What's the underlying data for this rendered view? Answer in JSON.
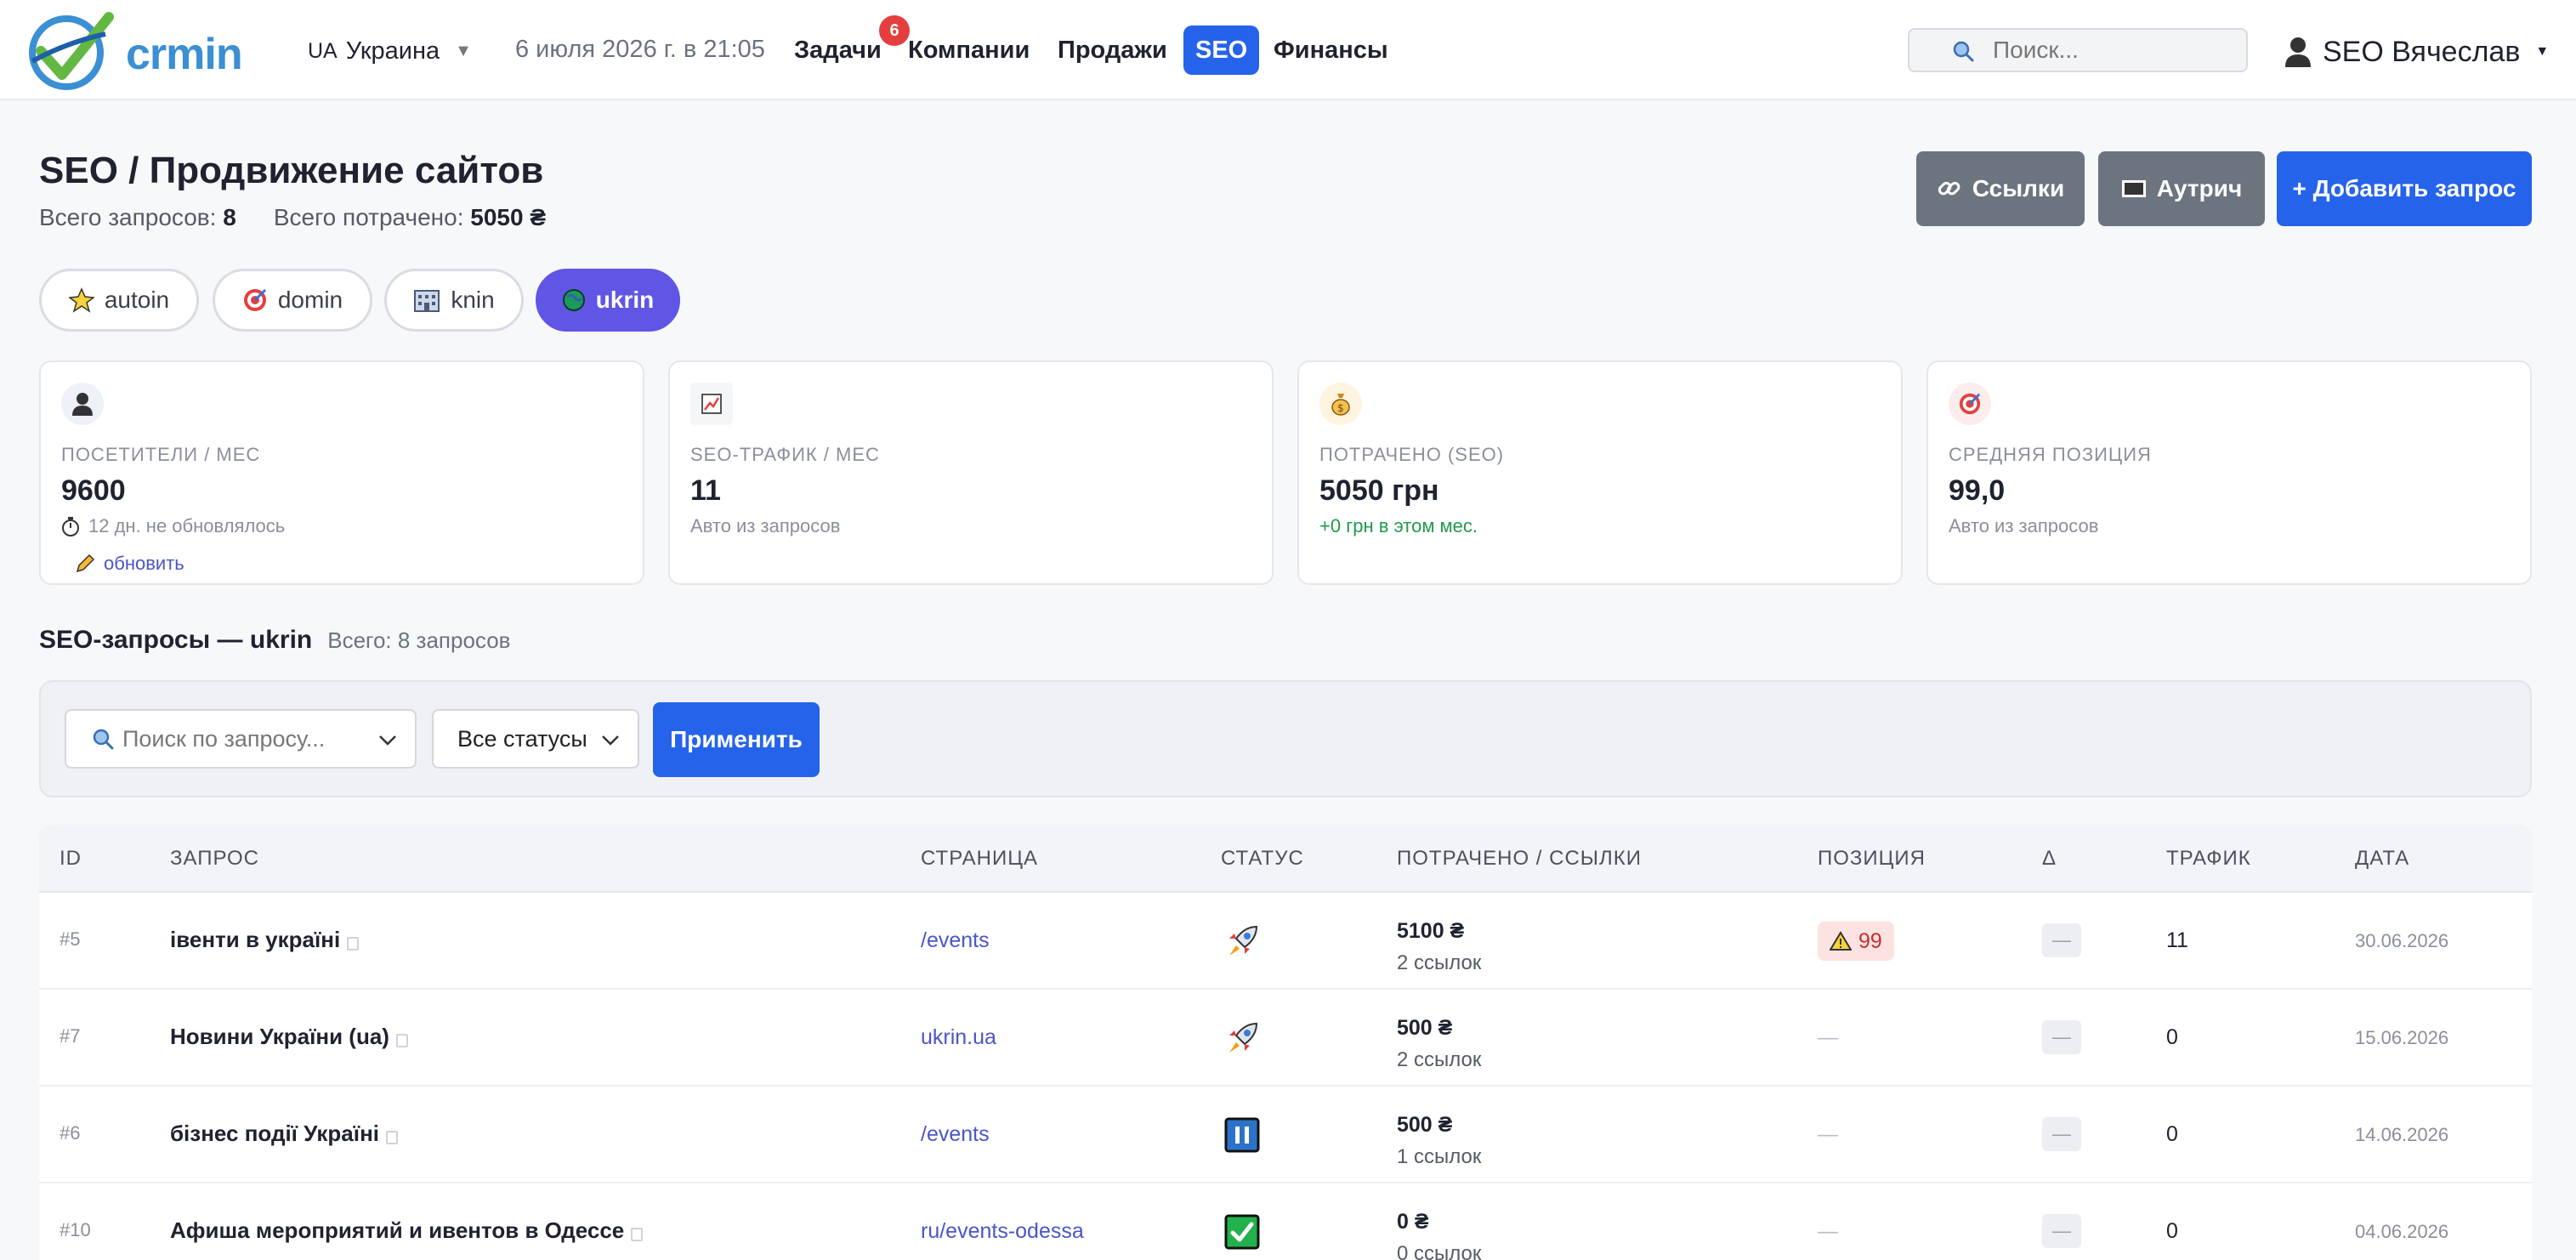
{
  "app": {
    "logo_text": "crmin"
  },
  "nav": {
    "country_code": "UA",
    "country_name": "Украина",
    "datetime": "6 июля 2026 г. в 21:05",
    "items": [
      "Задачи",
      "Компании",
      "Продажи",
      "SEO",
      "Финансы"
    ],
    "tasks_badge": "6",
    "search_placeholder": "Поиск...",
    "user_name": "SEO Вячеслав"
  },
  "header": {
    "title": "SEO / Продвижение сайтов",
    "total_requests_label": "Всего запросов:",
    "total_requests": "8",
    "total_spent_label": "Всего потрачено:",
    "total_spent": "5050 ₴",
    "btn_links": "Ссылки",
    "btn_outreach": "Аутрич",
    "btn_add": "+ Добавить запрос"
  },
  "projects": [
    "autoin",
    "domin",
    "knin",
    "ukrin"
  ],
  "active_project": "ukrin",
  "stats": [
    {
      "label": "ПОСЕТИТЕЛИ / МЕС",
      "value": "9600",
      "sub": "12 дн. не обновлялось",
      "link": "обновить",
      "icon": "user-icon"
    },
    {
      "label": "SEO-ТРАФИК / МЕС",
      "value": "11",
      "sub": "Авто из запросов",
      "icon": "chart-icon"
    },
    {
      "label": "ПОТРАЧЕНО (SEO)",
      "value": "5050 грн",
      "sub": "+0 грн в этом мес.",
      "icon": "money-bag-icon"
    },
    {
      "label": "СРЕДНЯЯ ПОЗИЦИЯ",
      "value": "99,0",
      "sub": "Авто из запросов",
      "icon": "target-icon"
    }
  ],
  "section": {
    "title": "SEO-запросы — ukrin",
    "count": "Всего: 8 запросов"
  },
  "filters": {
    "search_placeholder": "Поиск по запросу...",
    "status_value": "Все статусы",
    "apply": "Применить"
  },
  "table": {
    "columns": [
      "ID",
      "ЗАПРОС",
      "СТРАНИЦА",
      "СТАТУС",
      "ПОТРАЧЕНО / ССЫЛКИ",
      "ПОЗИЦИЯ",
      "Δ",
      "ТРАФИК",
      "ДАТА"
    ],
    "rows": [
      {
        "id": "#5",
        "query": "івенти в україні",
        "page": "/events",
        "status": "rocket",
        "spent": "5100 ₴",
        "links": "2 ссылок",
        "position": "99",
        "delta": "—",
        "traffic": "11",
        "date": "30.06.2026"
      },
      {
        "id": "#7",
        "query": "Новини України (ua)",
        "page": "ukrin.ua",
        "status": "rocket",
        "spent": "500 ₴",
        "links": "2 ссылок",
        "position": "—",
        "delta": "—",
        "traffic": "0",
        "date": "15.06.2026"
      },
      {
        "id": "#6",
        "query": "бізнес події Україні",
        "page": "/events",
        "status": "pause",
        "spent": "500 ₴",
        "links": "1 ссылок",
        "position": "—",
        "delta": "—",
        "traffic": "0",
        "date": "14.06.2026"
      },
      {
        "id": "#10",
        "query": "Афиша мероприятий и ивентов в Одессе",
        "page": "ru/events-odessa",
        "status": "check",
        "spent": "0 ₴",
        "links": "0 ссылок",
        "position": "—",
        "delta": "—",
        "traffic": "0",
        "date": "04.06.2026"
      }
    ]
  },
  "colors": {
    "primary": "#2563eb",
    "active_pill": "#6155e6",
    "gray_btn": "#6c747f",
    "badge": "#e53e3e"
  }
}
